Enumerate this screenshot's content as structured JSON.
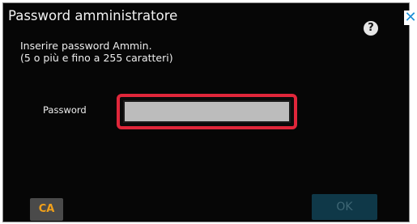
{
  "dialog": {
    "title": "Password amministratore",
    "instruction_line1": "Inserire password Ammin.",
    "instruction_line2": "(5 o più e fino a 255 caratteri)",
    "password_label": "Password",
    "password_value": "",
    "help_icon": "question-mark-icon",
    "help_glyph": "?",
    "close_icon": "close-icon",
    "close_glyph": "✕",
    "ca_label": "CA",
    "ok_label": "OK",
    "colors": {
      "background": "#060606",
      "field_highlight": "#e0263a",
      "ca_text": "#f2a11a",
      "ok_disabled_bg": "#0f3848",
      "close_icon": "#1d8fd6"
    }
  }
}
